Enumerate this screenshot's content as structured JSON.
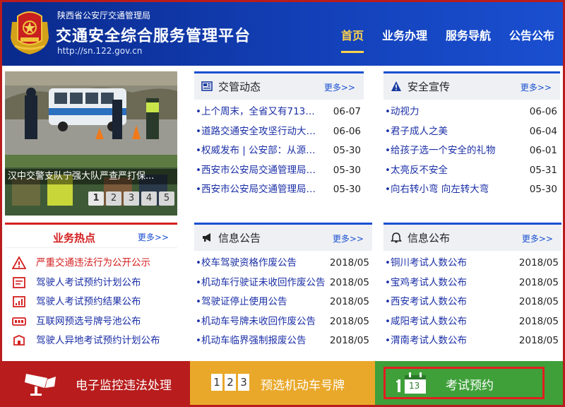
{
  "header": {
    "org": "陕西省公安厅交通管理局",
    "title": "交通安全综合服务管理平台",
    "url": "http://sn.122.gov.cn",
    "nav": [
      "首页",
      "业务办理",
      "服务导航",
      "公告公布"
    ],
    "active_index": 0
  },
  "slideshow": {
    "caption": "汉中交警支队宁强大队严查严打保...",
    "dots": [
      "1",
      "2",
      "3",
      "4",
      "5"
    ],
    "active_dot": 0
  },
  "news": {
    "title": "交管动态",
    "more": "更多>>",
    "items": [
      {
        "text": "上个周末，全省又有713只...",
        "date": "06-07"
      },
      {
        "text": "道路交通安全攻坚行动大曝...",
        "date": "06-06"
      },
      {
        "text": "权威发布 | 公安部：从源头...",
        "date": "05-30"
      },
      {
        "text": "西安市公安局交通管理局关...",
        "date": "05-30"
      },
      {
        "text": "西安市公安局交通管理局关...",
        "date": "05-30"
      }
    ]
  },
  "safety": {
    "title": "安全宣传",
    "more": "更多>>",
    "items": [
      {
        "text": "动视力",
        "date": "06-06"
      },
      {
        "text": "君子成人之美",
        "date": "06-04"
      },
      {
        "text": "给孩子选一个安全的礼物",
        "date": "06-01"
      },
      {
        "text": "太亮反不安全",
        "date": "05-31"
      },
      {
        "text": "向右转小弯 向左转大弯",
        "date": "05-30"
      }
    ]
  },
  "hot": {
    "title": "业务热点",
    "more": "更多>>",
    "items": [
      "严重交通违法行为公开公示",
      "驾驶人考试预约计划公布",
      "驾驶人考试预约结果公布",
      "互联网预选号牌号池公布",
      "驾驶人异地考试预约计划公布"
    ]
  },
  "notice": {
    "title": "信息公告",
    "more": "更多>>",
    "items": [
      {
        "text": "校车驾驶资格作废公告",
        "date": "2018/05"
      },
      {
        "text": "机动车行驶证未收回作废公告",
        "date": "2018/05"
      },
      {
        "text": "驾驶证停止使用公告",
        "date": "2018/05"
      },
      {
        "text": "机动车号牌未收回作废公告",
        "date": "2018/05"
      },
      {
        "text": "机动车临界强制报废公告",
        "date": "2018/05"
      }
    ]
  },
  "publish": {
    "title": "信息公布",
    "more": "更多>>",
    "items": [
      {
        "text": "铜川考试人数公布",
        "date": "2018/05"
      },
      {
        "text": "宝鸡考试人数公布",
        "date": "2018/05"
      },
      {
        "text": "西安考试人数公布",
        "date": "2018/05"
      },
      {
        "text": "咸阳考试人数公布",
        "date": "2018/05"
      },
      {
        "text": "渭南考试人数公布",
        "date": "2018/05"
      }
    ]
  },
  "bottom": {
    "monitor": "电子监控违法处理",
    "plate": "预选机动车号牌",
    "plate_digits": [
      "1",
      "2",
      "3"
    ],
    "exam": "考试预约",
    "exam_day": "13"
  },
  "colors": {
    "header_blue": "#1340b8",
    "accent_yellow": "#ffd34a",
    "hot_red": "#d42020",
    "bar_red": "#b81c1c",
    "bar_yellow": "#e9a82a",
    "bar_green": "#3fa03a",
    "highlight_red": "#e02020"
  }
}
